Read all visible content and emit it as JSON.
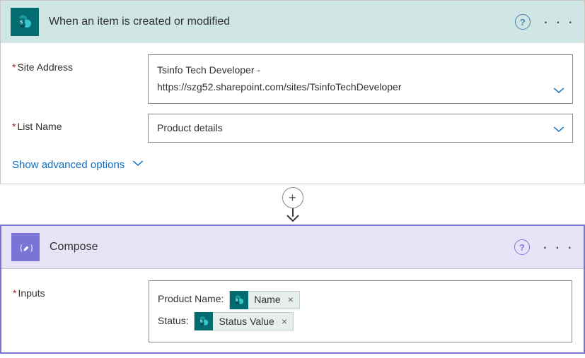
{
  "trigger": {
    "title": "When an item is created or modified",
    "fields": {
      "siteAddress": {
        "label": "Site Address",
        "value": "Tsinfo Tech Developer -\nhttps://szg52.sharepoint.com/sites/TsinfoTechDeveloper"
      },
      "listName": {
        "label": "List Name",
        "value": "Product details"
      }
    },
    "showAdvanced": "Show advanced options"
  },
  "compose": {
    "title": "Compose",
    "inputs": {
      "label": "Inputs",
      "lines": [
        {
          "prefix": "Product Name:",
          "token": "Name"
        },
        {
          "prefix": "Status:",
          "token": "Status Value"
        }
      ]
    }
  },
  "colors": {
    "sharepoint": "#036c70",
    "compose": "#7a74d6"
  }
}
